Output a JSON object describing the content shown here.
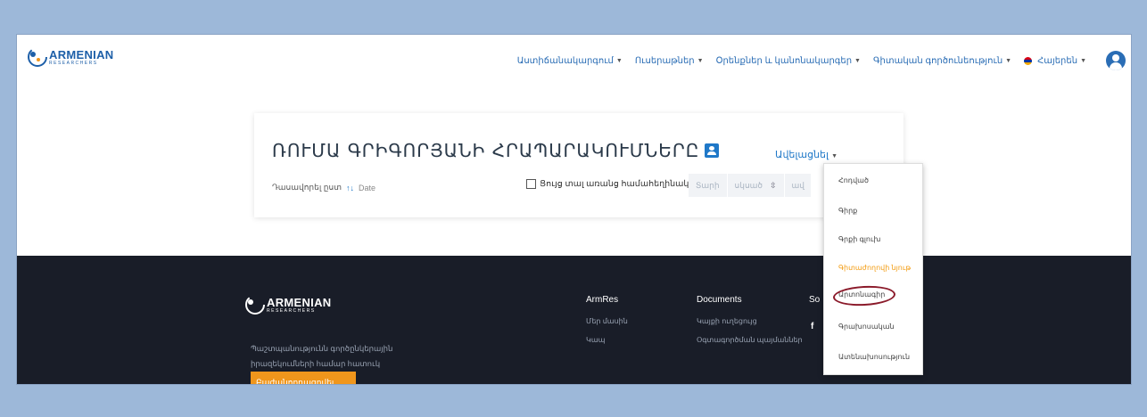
{
  "brand": {
    "name": "ARMENIAN",
    "sub": "RESEARCHERS"
  },
  "nav": {
    "items": [
      {
        "label": "Աստիճանակարգում"
      },
      {
        "label": "Ուսերաթներ"
      },
      {
        "label": "Օրենքներ և կանոնակարգեր"
      },
      {
        "label": "Գիտական գործունեություն"
      }
    ],
    "language": "Հայերեն"
  },
  "profile": {
    "title": "ՌՈՒՄԱ ԳՐԻԳՈՐՅԱՆԻ ՀՐԱՊԱՐԱԿՈՒՄՆԵՐԸ",
    "more_label": "Ավելացնել",
    "sort_label": "Դասավորել ըստ",
    "sort_icon": "↑↓",
    "sort_value": "Date",
    "checkbox_label": "Ցույց տալ առանց համահեղինակների",
    "filters": [
      "Տարի",
      "սկսած",
      "ավ"
    ]
  },
  "dropdown": {
    "items": [
      {
        "label": "Հոդված",
        "active": false
      },
      {
        "label": "Գիրք",
        "active": false
      },
      {
        "label": "Գրքի գլուխ",
        "active": false
      },
      {
        "label": "Գիտաժողովի նյութ",
        "active": true
      },
      {
        "label": "Արտոնագիր",
        "active": false
      },
      {
        "label": "Գրախոսական",
        "active": false
      },
      {
        "label": "Ատենախոսություն",
        "active": false
      }
    ]
  },
  "footer": {
    "description": "Պաշտպանությունն գործընկերային իրազեկումների համար հատուկ",
    "button_label": "Բաժանորդագրվել",
    "col1": {
      "title": "ArmRes",
      "links": [
        "Մեր մասին",
        "Կապ"
      ]
    },
    "col2": {
      "title": "Documents",
      "links": [
        "Կայքի ուղեցույց",
        "Օգտագործման պայմաններ"
      ]
    },
    "col3_partial": "So",
    "social_icon": "f"
  },
  "colors": {
    "accent": "#1f78c8",
    "footer_bg": "#191d28",
    "highlight": "#f39c12",
    "annotation": "#8b1a2a"
  }
}
